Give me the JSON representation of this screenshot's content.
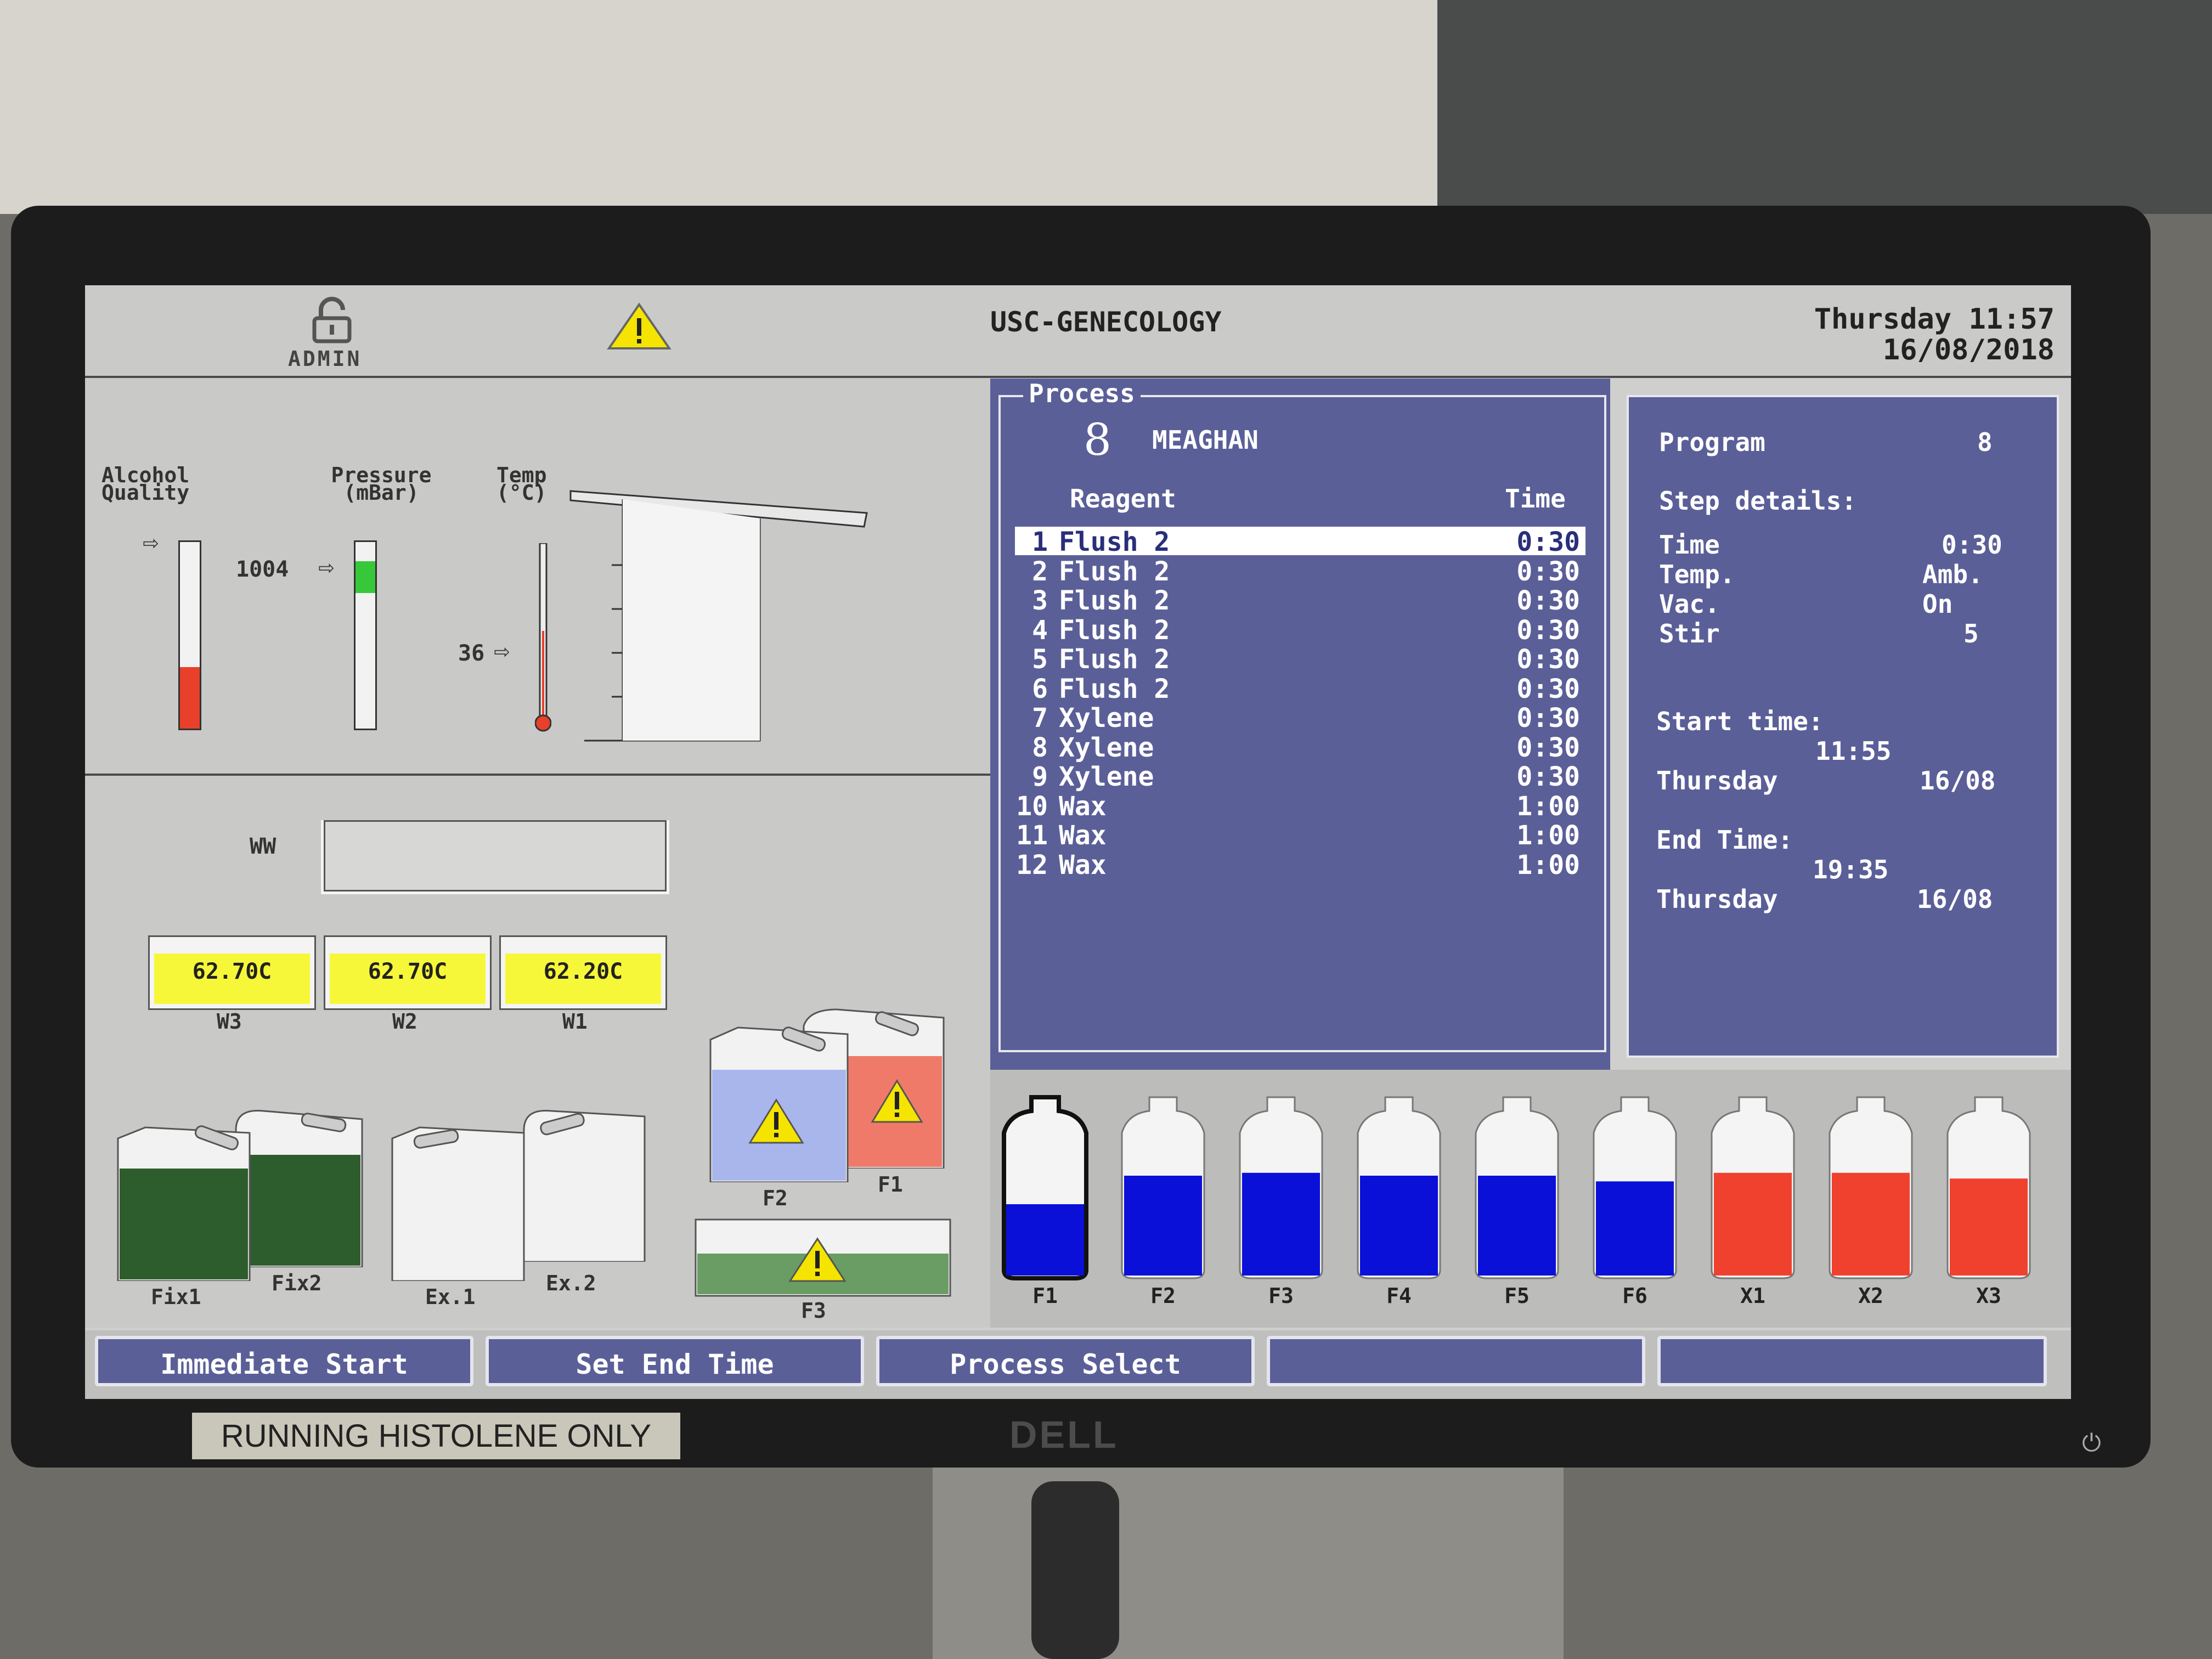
{
  "header": {
    "admin_label": "ADMIN",
    "title": "USC-GENECOLOGY",
    "day_time": "Thursday 11:57",
    "date": "16/08/2018"
  },
  "gauges": {
    "alcohol_label": "Alcohol Quality",
    "pressure_label": "Pressure (mBar)",
    "pressure_value": "1004",
    "temp_label": "Temp (°C)",
    "temp_value": "36",
    "alcohol_level": 0.33,
    "pressure_level": 0.17
  },
  "wax": {
    "ww_label": "WW",
    "baths": [
      {
        "label": "W3",
        "value": "62.70C"
      },
      {
        "label": "W2",
        "value": "62.70C"
      },
      {
        "label": "W1",
        "value": "62.20C"
      }
    ]
  },
  "containers": {
    "fix1": "Fix1",
    "fix2": "Fix2",
    "ex1": "Ex.1",
    "ex2": "Ex.2",
    "f1": "F1",
    "f2": "F2",
    "f3": "F3"
  },
  "process": {
    "section_label": "Process",
    "number": "8",
    "name": "MEAGHAN",
    "col_reagent": "Reagent",
    "col_time": "Time",
    "steps": [
      {
        "n": "1",
        "reagent": "Flush 2",
        "time": "0:30"
      },
      {
        "n": "2",
        "reagent": "Flush 2",
        "time": "0:30"
      },
      {
        "n": "3",
        "reagent": "Flush 2",
        "time": "0:30"
      },
      {
        "n": "4",
        "reagent": "Flush 2",
        "time": "0:30"
      },
      {
        "n": "5",
        "reagent": "Flush 2",
        "time": "0:30"
      },
      {
        "n": "6",
        "reagent": "Flush 2",
        "time": "0:30"
      },
      {
        "n": "7",
        "reagent": "Xylene",
        "time": "0:30"
      },
      {
        "n": "8",
        "reagent": "Xylene",
        "time": "0:30"
      },
      {
        "n": "9",
        "reagent": "Xylene",
        "time": "0:30"
      },
      {
        "n": "10",
        "reagent": "Wax",
        "time": "1:00"
      },
      {
        "n": "11",
        "reagent": "Wax",
        "time": "1:00"
      },
      {
        "n": "12",
        "reagent": "Wax",
        "time": "1:00"
      }
    ]
  },
  "details": {
    "program_label": "Program",
    "program_value": "8",
    "step_details_label": "Step details:",
    "time_label": "Time",
    "time_value": "0:30",
    "temp_label": "Temp.",
    "temp_value": "Amb.",
    "vac_label": "Vac.",
    "vac_value": "On",
    "stir_label": "Stir",
    "stir_value": "5",
    "start_label": "Start time:",
    "start_time": "11:55",
    "start_day": "Thursday",
    "start_date": "16/08",
    "end_label": "End Time:",
    "end_time": "19:35",
    "end_day": "Thursday",
    "end_date": "16/08"
  },
  "bottles": [
    {
      "label": "F1",
      "level": 0.5,
      "color": "#0a10d8"
    },
    {
      "label": "F2",
      "level": 0.7,
      "color": "#0a10d8"
    },
    {
      "label": "F3",
      "level": 0.72,
      "color": "#0a10d8"
    },
    {
      "label": "F4",
      "level": 0.7,
      "color": "#0a10d8"
    },
    {
      "label": "F5",
      "level": 0.7,
      "color": "#0a10d8"
    },
    {
      "label": "F6",
      "level": 0.66,
      "color": "#0a10d8"
    },
    {
      "label": "X1",
      "level": 0.72,
      "color": "#f0412f"
    },
    {
      "label": "X2",
      "level": 0.72,
      "color": "#f0412f"
    },
    {
      "label": "X3",
      "level": 0.68,
      "color": "#f0412f"
    }
  ],
  "buttons": {
    "immediate_start": "Immediate Start",
    "set_end_time": "Set End Time",
    "process_select": "Process Select",
    "blank4": "",
    "blank5": ""
  },
  "sticker": "RUNNING HISTOLENE ONLY",
  "brand": "DELL",
  "colors": {
    "panel_blue": "#5b5f98",
    "wax_yellow": "#f7f73a",
    "fixative_green": "#2e5d2d",
    "warning_yellow": "#f4e400"
  }
}
